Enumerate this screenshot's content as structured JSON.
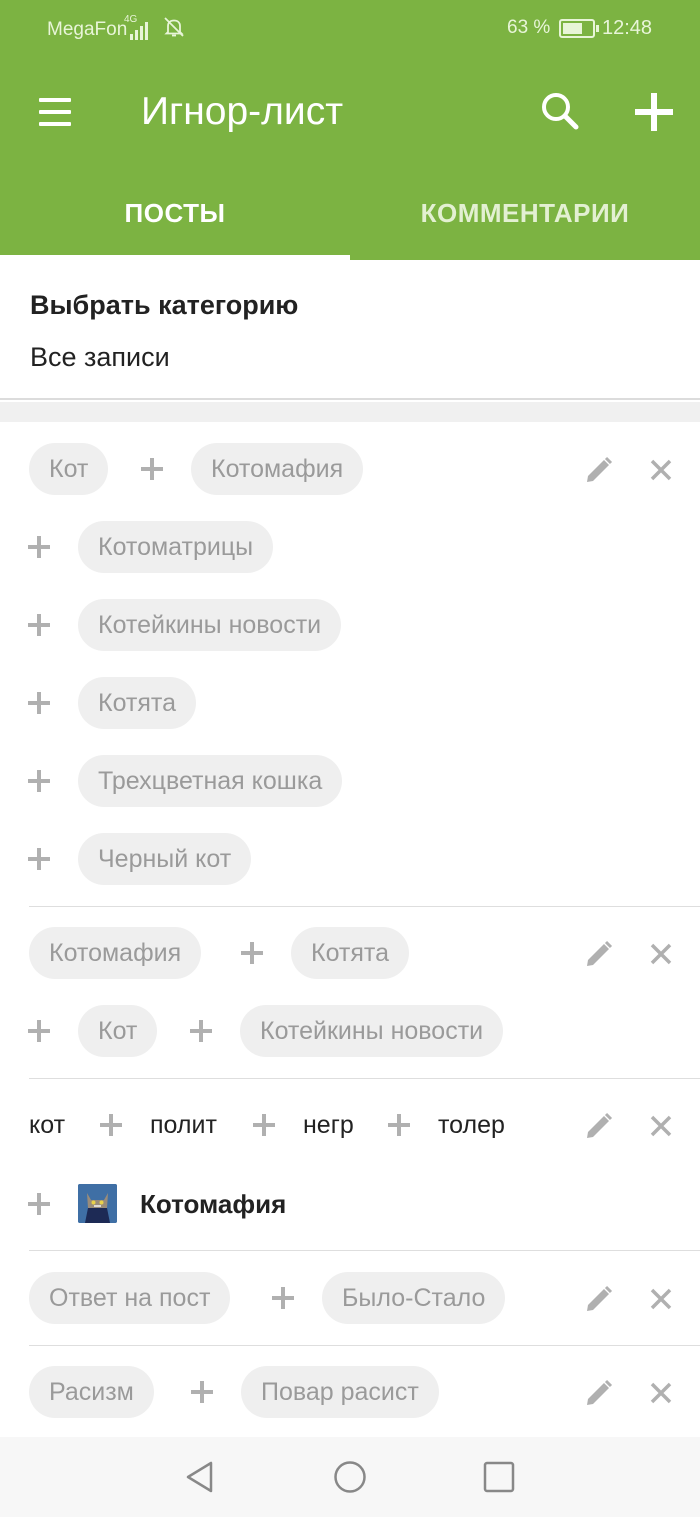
{
  "status_bar": {
    "carrier": "MegaFon",
    "network": "4G",
    "battery_percent": "63 %",
    "battery_level": 0.63,
    "time": "12:48"
  },
  "app_bar": {
    "title": "Игнор-лист",
    "menu_icon": "hamburger-menu-icon",
    "search_icon": "search-icon",
    "add_icon": "plus-icon",
    "color": "#7cb342"
  },
  "tabs": [
    {
      "label": "ПОСТЫ",
      "selected": true
    },
    {
      "label": "КОММЕНТАРИИ",
      "selected": false
    }
  ],
  "category": {
    "label": "Выбрать категорию",
    "value": "Все записи"
  },
  "rules": {
    "r1": {
      "tags": [
        "Кот",
        "Котомафия",
        "Котоматрицы",
        "Котейкины новости",
        "Котята",
        "Трехцветная кошка",
        "Черный кот"
      ]
    },
    "r2": {
      "tags": [
        "Котомафия",
        "Котята",
        "Кот",
        "Котейкины новости"
      ]
    },
    "r3": {
      "keywords": [
        "кот",
        "полит",
        "негр",
        "толер"
      ],
      "community": "Котомафия"
    },
    "r4": {
      "tags": [
        "Ответ на пост",
        "Было-Стало"
      ]
    },
    "r5": {
      "tags": [
        "Расизм",
        "Повар расист"
      ]
    }
  },
  "nav_bar": {
    "back_icon": "back-triangle-icon",
    "home_icon": "home-circle-icon",
    "recent_icon": "recent-square-icon"
  }
}
